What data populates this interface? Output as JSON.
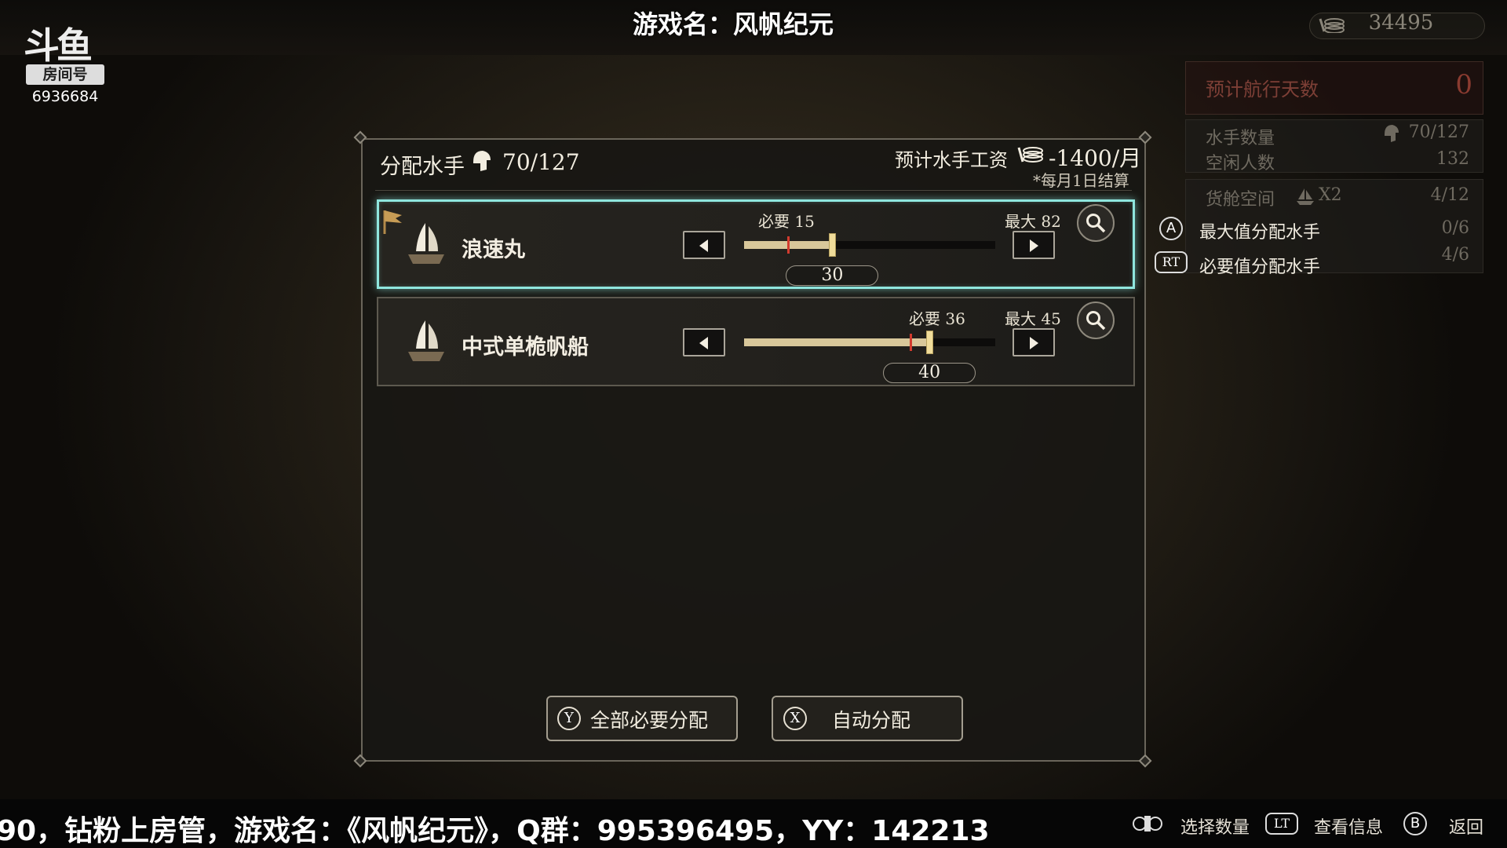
{
  "header": {
    "game_title": "游戏名：风帆纪元",
    "room_label": "房间号",
    "room_number": "6936684",
    "money": "34495"
  },
  "right_panel": {
    "days_label": "预计航行天数",
    "days_value": "0",
    "crew_label": "水手数量",
    "crew_value": "70/127",
    "idle_label": "空闲人数",
    "idle_value": "132",
    "cargo_label": "货舱空间",
    "cargo_mult": "X2",
    "cargo_value": "4/12",
    "row4_value": "0/6",
    "row5_value": "4/6"
  },
  "hints": [
    {
      "key": "A",
      "label": "最大值分配水手"
    },
    {
      "key": "RT",
      "label": "必要值分配水手"
    }
  ],
  "panel": {
    "title": "分配水手",
    "count": "70/127",
    "wage_label": "预计水手工资",
    "wage_value": "-1400/月",
    "wage_note": "*每月1日结算"
  },
  "ships": [
    {
      "name": "浪速丸",
      "required_label": "必要 15",
      "max_label": "最大 82",
      "value": "30",
      "required": 15,
      "max": 82,
      "assigned": 30,
      "selected": true,
      "flag": true
    },
    {
      "name": "中式单桅帆船",
      "required_label": "必要 36",
      "max_label": "最大 45",
      "value": "40",
      "required": 36,
      "max": 45,
      "assigned": 40,
      "selected": false,
      "flag": false
    }
  ],
  "actions": [
    {
      "key": "Y",
      "label": "全部必要分配"
    },
    {
      "key": "X",
      "label": "自动分配"
    }
  ],
  "footer": {
    "ticker": "90，钻粉上房管，游戏名：《风帆纪元》，Q群：995396495，YY：142213",
    "controls": [
      {
        "key": "",
        "label": "选择数量"
      },
      {
        "key": "LT",
        "label": "查看信息"
      },
      {
        "key": "B",
        "label": "返回"
      }
    ]
  },
  "colors": {
    "selected_border": "#8fe6de",
    "slider_fill": "#d8c79a",
    "required_marker": "#d23b2e",
    "days_red": "#8a3b30"
  }
}
